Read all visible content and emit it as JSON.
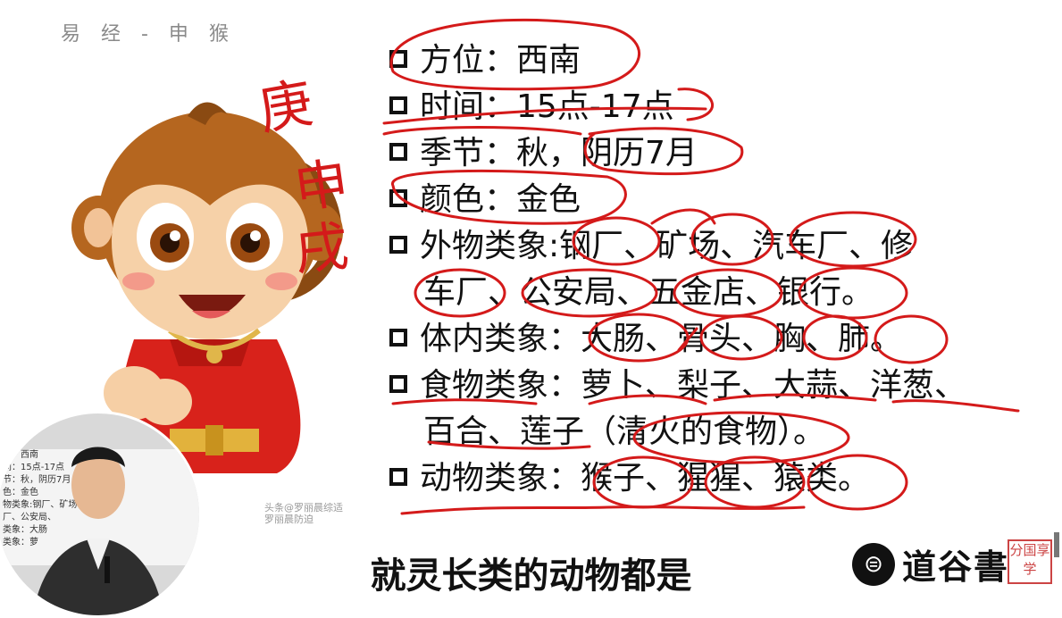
{
  "slide": {
    "header_title": "易 经 - 申 猴",
    "items": [
      {
        "lines": [
          "方位：西南"
        ]
      },
      {
        "lines": [
          "时间：15点-17点"
        ]
      },
      {
        "lines": [
          "季节：秋，阴历7月"
        ]
      },
      {
        "lines": [
          "颜色：金色"
        ]
      },
      {
        "lines": [
          "外物类象:钢厂、矿场、汽车厂、修",
          "车厂、公安局、五金店、银行。"
        ]
      },
      {
        "lines": [
          "体内类象：大肠、骨头、胸、肺。"
        ]
      },
      {
        "lines": [
          "食物类象：萝卜、梨子、大蒜、洋葱、",
          "百合、莲子（清火的食物）。"
        ]
      },
      {
        "lines": [
          "动物类象：猴子、猩猩、猿类。"
        ]
      }
    ]
  },
  "handwriting": [
    "庚",
    "申",
    "戌"
  ],
  "subtitle": "就灵长类的动物都是",
  "watermark": {
    "line1": "头条@罗丽晨综适",
    "line2": "罗丽晨防迫"
  },
  "logo": {
    "text": "道谷書",
    "seal": "分国享学"
  },
  "webcam": {
    "board_lines": [
      "立：西南",
      "间：15点-17点",
      "节：秋，阴历7月",
      "色：金色",
      "物类象:钢厂、矿场",
      "厂、公安局、",
      "类象：大肠",
      "类象：萝"
    ]
  },
  "colors": {
    "ink": "#d41a1a",
    "text": "#111111",
    "header": "#8a8a8a"
  }
}
